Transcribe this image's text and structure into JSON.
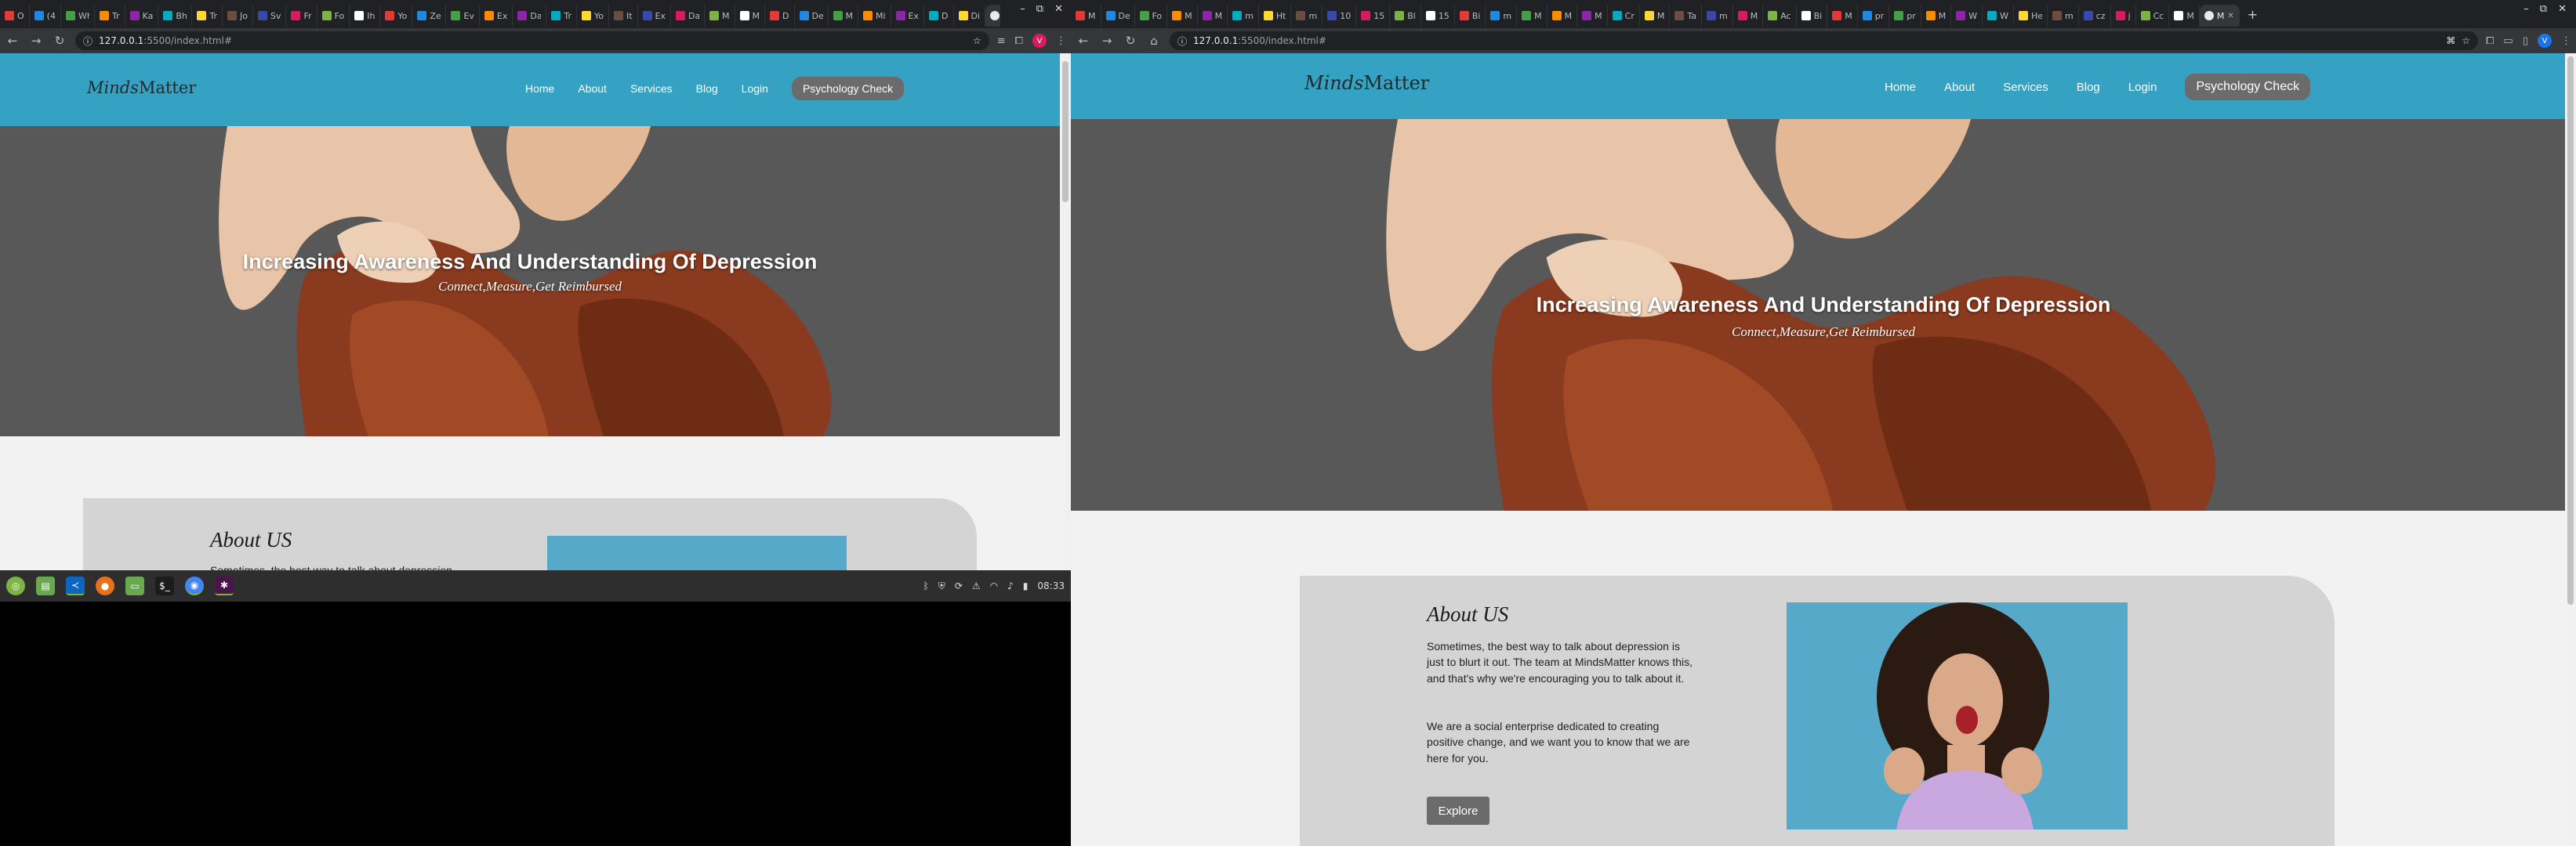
{
  "left": {
    "tabs": [
      "O",
      "(4",
      "Wh",
      "Tr",
      "Ka",
      "Bh",
      "Tr",
      "Jo",
      "Sv",
      "Fr",
      "Fo",
      "Ih",
      "Yo",
      "Ze",
      "Ev",
      "Ex",
      "Da",
      "Tr",
      "Yo",
      "It",
      "Ex",
      "Da",
      "M",
      "M",
      "D",
      "De",
      "M",
      "Mi",
      "Ex",
      "D",
      "Di"
    ],
    "active_tab_label": "D",
    "url_host": "127.0.0.1",
    "url_path": ":5500/index.html#",
    "profile_initial": "V"
  },
  "right": {
    "tabs": [
      "M",
      "De",
      "Fo",
      "M",
      "M",
      "m",
      "Ht",
      "m",
      "10",
      "15",
      "Bl",
      "15",
      "Bi",
      "m",
      "M",
      "M",
      "M",
      "Cr",
      "M",
      "Ta",
      "m",
      "M",
      "Ac",
      "Bi",
      "M",
      "pr",
      "pr",
      "M",
      "W",
      "W",
      "He",
      "m",
      "cz",
      "j",
      "Cc",
      "M"
    ],
    "active_tab_label": "M",
    "url_host": "127.0.0.1",
    "url_path": ":5500/index.html#",
    "profile_initial": "V"
  },
  "site": {
    "logo_italic": "Minds",
    "logo_rest": "Matter",
    "nav": {
      "home": "Home",
      "about": "About",
      "services": "Services",
      "blog": "Blog",
      "login": "Login",
      "cta": "Psychology Check"
    },
    "hero_title": "Increasing Awareness And Understanding Of Depression",
    "hero_subtitle": "Connect,Measure,Get  Reimbursed",
    "about_title": "About US",
    "about_p1": "Sometimes, the best way to talk about depression is just to blurt it out. The team at MindsMatter knows this, and that's why we're encouraging you to talk about it.",
    "about_p2": "We are a social enterprise dedicated to creating positive change, and we want you to know that we are here for you.",
    "explore": "Explore",
    "about_p1_fragment": "Sometimes, the best way to talk about depression"
  },
  "taskbar": {
    "clock": "08:33"
  },
  "colors": {
    "navbar": "#35a2c4",
    "button": "#6b6b6b",
    "about_bg": "#d4d4d4",
    "page_bg": "#f2f2f2"
  }
}
